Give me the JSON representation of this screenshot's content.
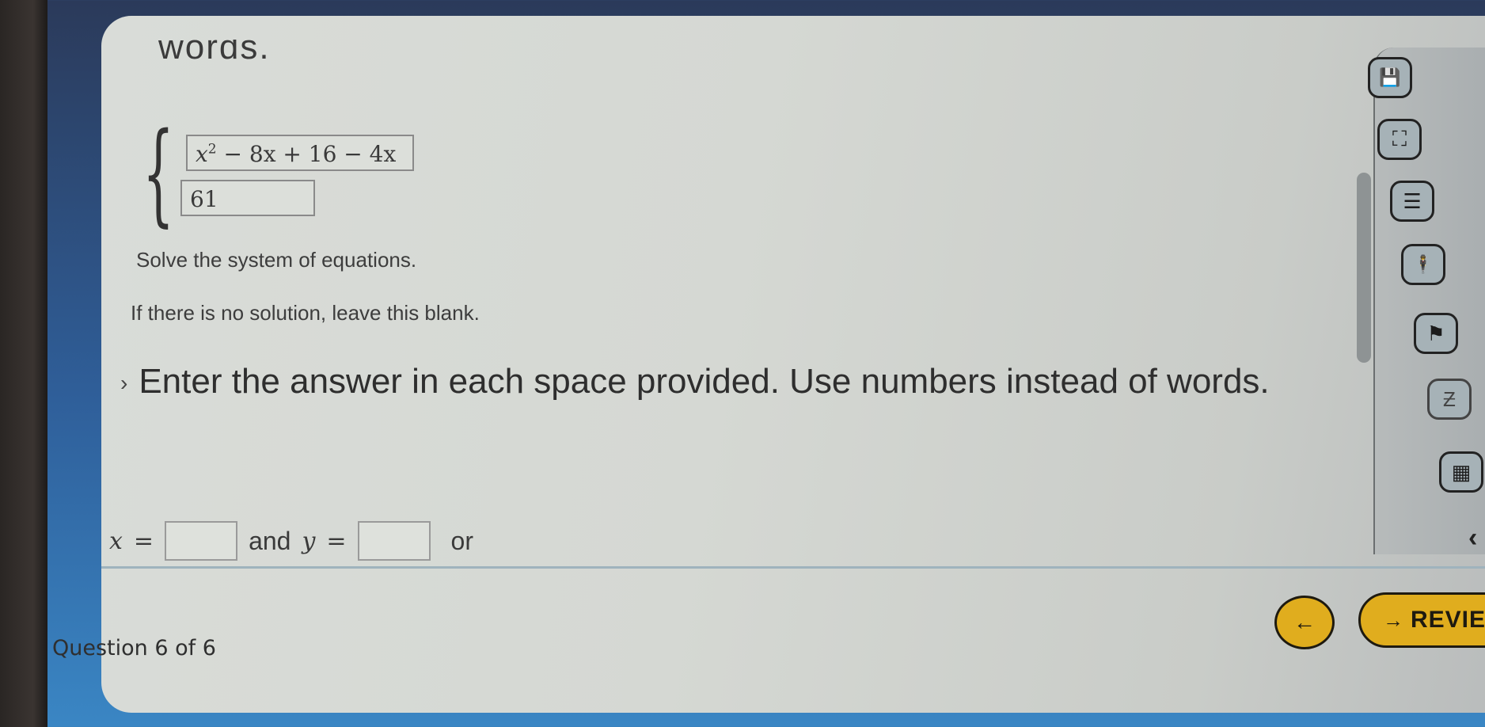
{
  "question": {
    "cut_off_text": "words.",
    "system": {
      "equation_1": {
        "base": "x",
        "exponent": "2",
        "rest": " − 8x + 16 − 4x"
      },
      "equation_2": "61"
    },
    "prompt": "Solve the system of equations.",
    "note": "If there is no solution, leave this blank.",
    "instruction": "Enter the answer in each space provided. Use numbers instead of words.",
    "answer_row": {
      "x_label": "x",
      "y_label": "y",
      "equals": "=",
      "and_label": "and",
      "or_label": "or",
      "x_value": "",
      "y_value": ""
    }
  },
  "footer": {
    "progress_text": "Question 6 of 6",
    "back_icon": "←",
    "review_icon": "→",
    "review_label": "REVIEW"
  },
  "toolbar": {
    "icons": [
      {
        "name": "save-icon",
        "glyph": "💾"
      },
      {
        "name": "fullscreen-icon",
        "glyph": "⛶"
      },
      {
        "name": "list-icon",
        "glyph": "☰"
      },
      {
        "name": "accessibility-icon",
        "glyph": "🕴"
      },
      {
        "name": "flag-icon",
        "glyph": "⚑"
      },
      {
        "name": "text-off-icon",
        "glyph": "Ƶ"
      },
      {
        "name": "calculator-icon",
        "glyph": "▦"
      }
    ],
    "collapse_icon": "‹"
  },
  "colors": {
    "accent_button": "#e0ad1e",
    "card_background": "#d7dad6",
    "page_background": "#2f5f9a"
  }
}
